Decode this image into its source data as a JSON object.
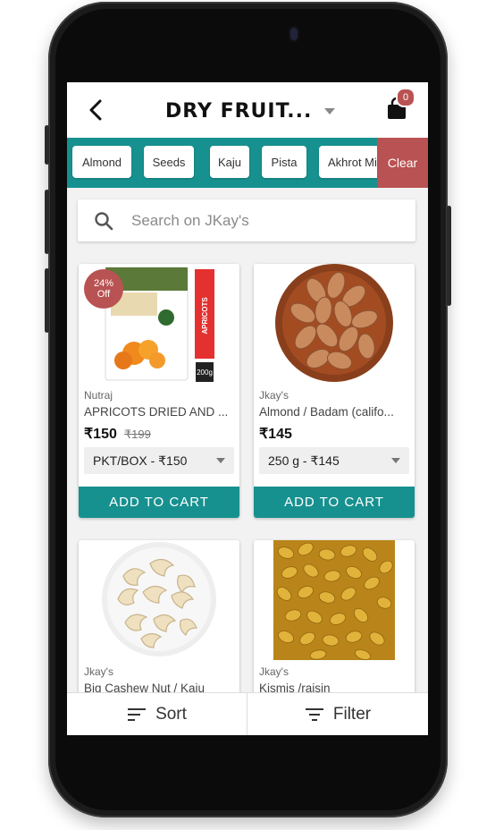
{
  "header": {
    "title": "DRY FRUIT...",
    "cart_count": "0"
  },
  "categories": {
    "chips": [
      "Almond",
      "Seeds",
      "Kaju",
      "Pista",
      "Akhrot Mi"
    ],
    "clear_label": "Clear"
  },
  "search": {
    "placeholder": "Search on JKay's"
  },
  "products": [
    {
      "brand": "Nutraj",
      "name": "APRICOTS DRIED AND ...",
      "price": "₹150",
      "mrp": "₹199",
      "variant": "PKT/BOX - ₹150",
      "add_label": "ADD TO CART",
      "discount_pct": "24%",
      "discount_off": "Off",
      "pack_label": "APRICOTS",
      "pack_weight": "200g"
    },
    {
      "brand": "Jkay's",
      "name": "Almond / Badam (califo...",
      "price": "₹145",
      "variant": "250 g - ₹145",
      "add_label": "ADD TO CART"
    },
    {
      "brand": "Jkay's",
      "name": "Big Cashew Nut / Kaju"
    },
    {
      "brand": "Jkay's",
      "name": "Kismis /raisin"
    }
  ],
  "bottom_bar": {
    "sort_label": "Sort",
    "filter_label": "Filter"
  },
  "colors": {
    "teal": "#17918f",
    "badge_red": "#b95252"
  },
  "icons": [
    "back-arrow-icon",
    "dropdown-caret-icon",
    "shopping-bag-icon",
    "search-icon",
    "sort-icon",
    "filter-icon"
  ]
}
